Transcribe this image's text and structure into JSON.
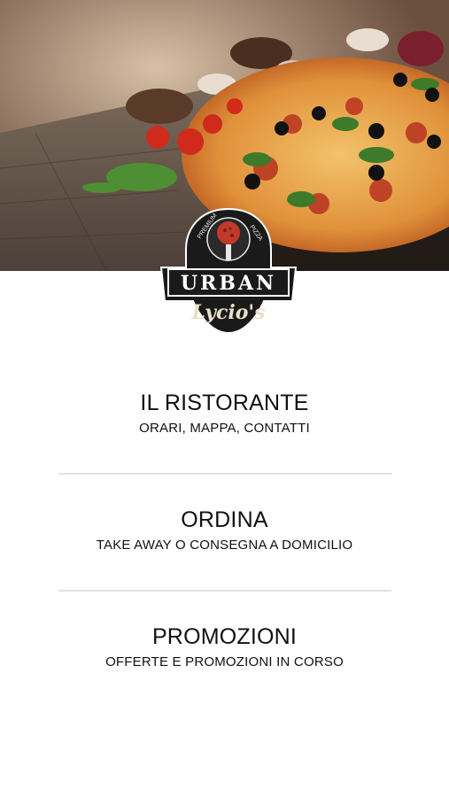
{
  "hero": {
    "image": "pizza-photo"
  },
  "logo": {
    "top_text": "PREMIUM",
    "side_text": "PIZZA",
    "brand": "URBAN",
    "script": "Lycio's"
  },
  "menu": {
    "items": [
      {
        "title": "IL RISTORANTE",
        "subtitle": "ORARI, MAPPA, CONTATTI"
      },
      {
        "title": "ORDINA",
        "subtitle": "TAKE AWAY O CONSEGNA A DOMICILIO"
      },
      {
        "title": "PROMOZIONI",
        "subtitle": "OFFERTE E PROMOZIONI IN CORSO"
      }
    ]
  },
  "colors": {
    "text": "#111111",
    "divider": "#e2e2e2",
    "logo_dark": "#1a1a1a",
    "logo_red": "#c0392b"
  }
}
